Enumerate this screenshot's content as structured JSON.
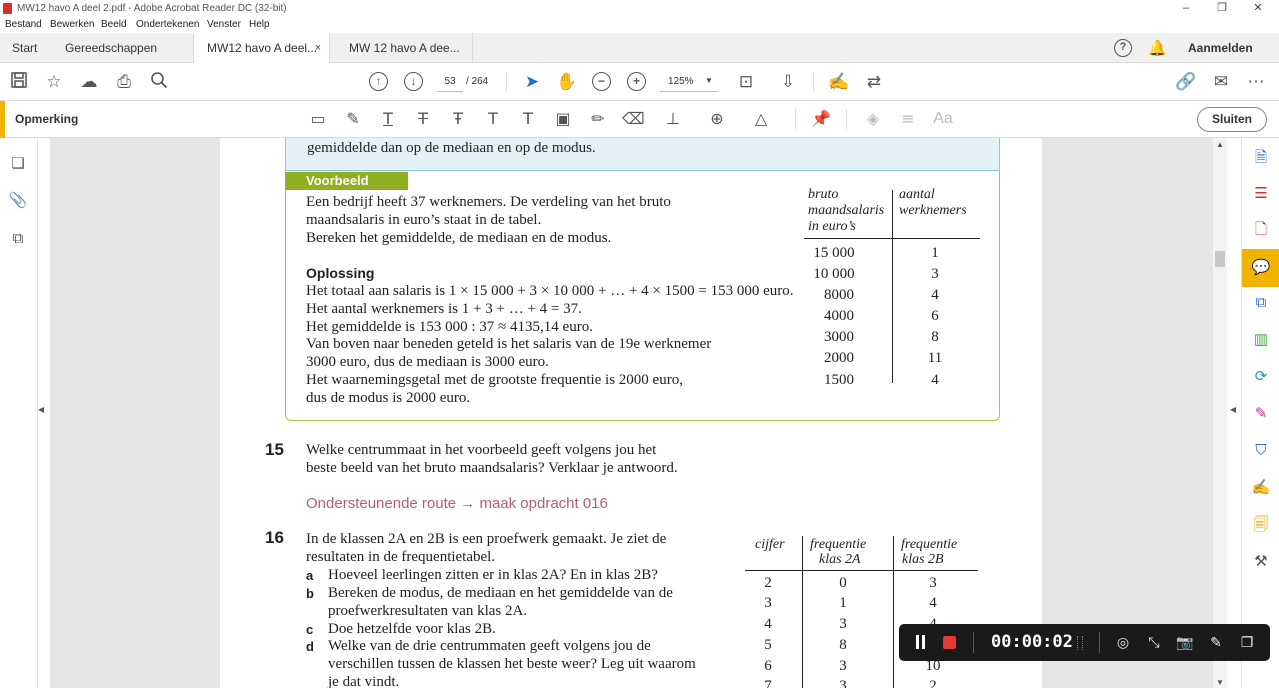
{
  "window": {
    "title": "MW12 havo A deel 2.pdf - Adobe Acrobat Reader DC (32-bit)",
    "controls": [
      "–",
      "❐",
      "✕"
    ]
  },
  "menu": [
    "Bestand",
    "Bewerken",
    "Beeld",
    "Ondertekenen",
    "Venster",
    "Help"
  ],
  "tabs": {
    "home": "Start",
    "tools": "Gereedschappen",
    "doc1": "MW12 havo A deel...",
    "doc1_close": "×",
    "doc2": "MW 12 havo A dee...",
    "help": "?",
    "signin": "Aanmelden"
  },
  "toolbar": {
    "page_current": "53",
    "page_total": "/ 264",
    "zoom": "125%"
  },
  "commentbar": {
    "label": "Opmerking",
    "close": "Sluiten"
  },
  "colors": {
    "accent": "#f0b400",
    "voorbeeld_green": "#8fb020",
    "route_pink": "#b0607a",
    "box_blue": "#e4f2f8",
    "record_red": "#e53935"
  },
  "document": {
    "intro_tail": "gemiddelde dan op de mediaan en op de modus.",
    "voorbeeld_label": "Voorbeeld",
    "voorbeeld_lines": [
      "Een bedrijf heeft 37 werknemers. De verdeling van het bruto",
      "maandsalaris in euro’s staat in de tabel.",
      "Bereken het gemiddelde, de mediaan en de modus."
    ],
    "oplossing_label": "Oplossing",
    "oplossing_lines": [
      "Het totaal aan salaris is 1 × 15 000 + 3 × 10 000 + … + 4 × 1500 = 153 000 euro.",
      "Het aantal werknemers is 1 + 3 + … + 4 = 37.",
      "Het gemiddelde is 153 000 : 37 ≈ 4135,14 euro.",
      "Van boven naar beneden geteld is het salaris van de 19e werknemer",
      "3000 euro, dus de mediaan is 3000 euro.",
      "Het waarnemingsgetal met de grootste frequentie is 2000 euro,",
      "dus de modus is 2000 euro."
    ],
    "salary_table": {
      "col1_header": [
        "bruto",
        "maandsalaris",
        "in euro’s"
      ],
      "col2_header": [
        "aantal",
        "werknemers"
      ],
      "rows": [
        [
          "15 000",
          "1"
        ],
        [
          "10 000",
          "3"
        ],
        [
          "8000",
          "4"
        ],
        [
          "4000",
          "6"
        ],
        [
          "3000",
          "8"
        ],
        [
          "2000",
          "11"
        ],
        [
          "1500",
          "4"
        ]
      ]
    },
    "q15": {
      "number": "15",
      "lines": [
        "Welke centrummaat in het voorbeeld geeft volgens jou het",
        "beste beeld van het bruto maandsalaris? Verklaar je antwoord."
      ]
    },
    "route": "Ondersteunende route → maak opdracht 016",
    "q16": {
      "number": "16",
      "lines": [
        "In de klassen 2A en 2B is een proefwerk gemaakt. Je ziet de",
        "resultaten in de frequentietabel."
      ],
      "parts": [
        {
          "letter": "a",
          "lines": [
            "Hoeveel leerlingen zitten er in klas 2A? En in klas 2B?"
          ]
        },
        {
          "letter": "b",
          "lines": [
            "Bereken de modus, de mediaan en het gemiddelde van de",
            "proefwerkresultaten van klas 2A."
          ]
        },
        {
          "letter": "c",
          "lines": [
            "Doe hetzelfde voor klas 2B."
          ]
        },
        {
          "letter": "d",
          "lines": [
            "Welke van de drie centrummaten geeft volgens jou de",
            "verschillen tussen de klassen het beste weer? Leg uit waarom",
            "je dat vindt."
          ]
        }
      ]
    },
    "freq_table": {
      "headers": [
        "cijfer",
        "frequentie",
        "klas 2A",
        "frequentie",
        "klas 2B"
      ],
      "rows": [
        [
          "2",
          "0",
          "3"
        ],
        [
          "3",
          "1",
          "4"
        ],
        [
          "4",
          "3",
          "4"
        ],
        [
          "5",
          "8",
          ""
        ],
        [
          "6",
          "3",
          "10"
        ],
        [
          "7",
          "3",
          "2"
        ]
      ]
    }
  },
  "recorder": {
    "timer": "00:00:02"
  }
}
